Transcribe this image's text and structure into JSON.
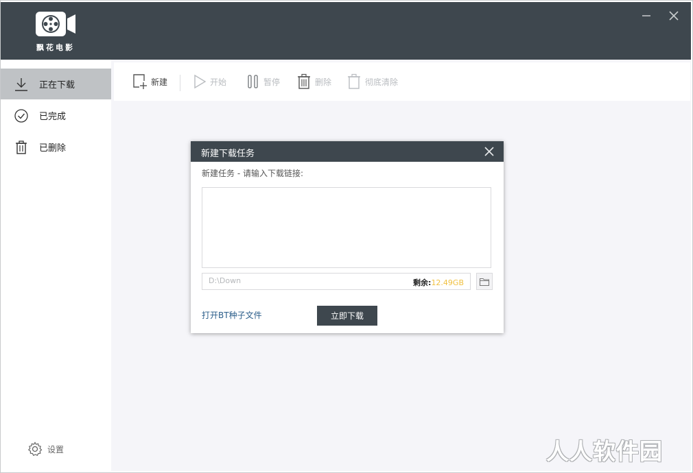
{
  "app": {
    "logo_text": "飘花电影"
  },
  "window": {
    "minimize_label": "−",
    "close_label": "✕"
  },
  "sidebar": {
    "items": [
      {
        "label": "正在下载",
        "icon": "download-icon",
        "active": true
      },
      {
        "label": "已完成",
        "icon": "check-circle-icon",
        "active": false
      },
      {
        "label": "已删除",
        "icon": "trash-icon",
        "active": false
      }
    ],
    "settings_label": "设置"
  },
  "toolbar": {
    "new_label": "新建",
    "start_label": "开始",
    "pause_label": "暂停",
    "delete_label": "删除",
    "purge_label": "彻底清除"
  },
  "dialog": {
    "title": "新建下载任务",
    "subtitle": "新建任务 - 请输入下载链接:",
    "url_value": "",
    "path_value": "D:\\Down",
    "free_label": "剩余:",
    "free_value": "12.49GB",
    "bt_link": "打开BT种子文件",
    "download_button": "立即下载"
  },
  "watermark": "人人软件园",
  "colors": {
    "header_bg": "#3e474e",
    "sidebar_active": "#bfc2c5",
    "main_bg": "#f5f5f9",
    "link": "#2a5d8a",
    "free_space": "#f0c040"
  }
}
